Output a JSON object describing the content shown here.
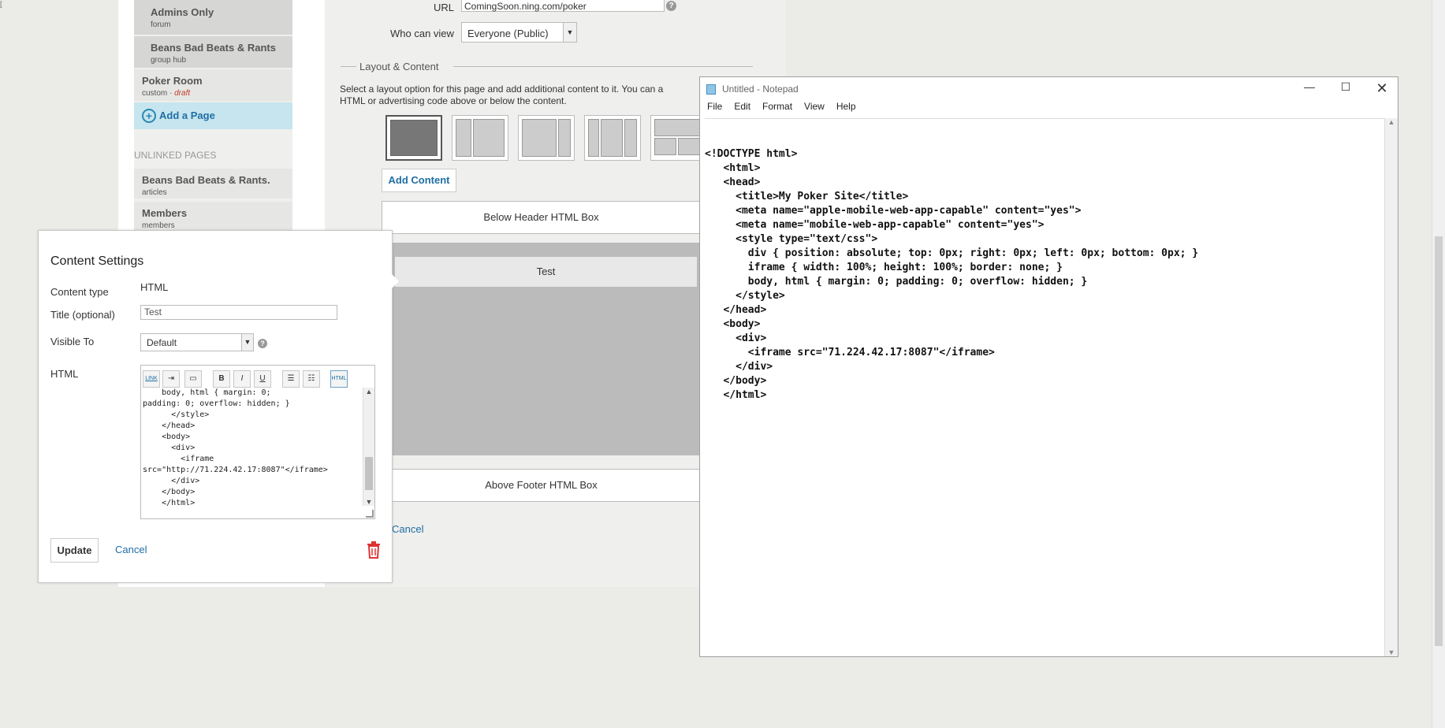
{
  "sidebar": {
    "items": [
      {
        "title": "Admins Only",
        "subtitle": "forum"
      },
      {
        "title": "Beans Bad Beats & Rants",
        "subtitle": "group hub"
      },
      {
        "title": "Poker Room",
        "subtitle": "custom",
        "status": "draft",
        "separator": " · "
      }
    ],
    "add_page": "Add a Page",
    "unlinked_heading": "UNLINKED PAGES",
    "unlinked": [
      {
        "title": "Beans Bad Beats & Rants.",
        "subtitle": "articles"
      },
      {
        "title": "Members",
        "subtitle": "members"
      }
    ]
  },
  "main": {
    "url_label": "URL",
    "url_prefix": "ComingSoon.ning.com/",
    "url_value": "poker",
    "who_label": "Who can view",
    "who_value": "Everyone (Public)",
    "section_title": "Layout & Content",
    "desc_line1": "Select a layout option for this page and add additional content to it. You can a",
    "desc_line2": "HTML or advertising code above or below the content.",
    "add_content": "Add Content",
    "below_header": "Below Header HTML Box",
    "test_bar": "Test",
    "above_footer": "Above Footer HTML Box",
    "cancel": "Cancel"
  },
  "content_settings": {
    "title": "Content Settings",
    "content_type_label": "Content type",
    "content_type_value": "HTML",
    "title_label": "Title (optional)",
    "title_value": "Test",
    "visible_label": "Visible To",
    "visible_value": "Default",
    "html_label": "HTML",
    "toolbar": {
      "link": "LINK",
      "bold": "B",
      "italic": "I",
      "underline": "U",
      "html": "HTML"
    },
    "code": "    body, html { margin: 0;\npadding: 0; overflow: hidden; }\n      </style>\n    </head>\n    <body>\n      <div>\n        <iframe\nsrc=\"http://71.224.42.17:8087\"</iframe>\n      </div>\n    </body>\n    </html>",
    "update": "Update",
    "cancel": "Cancel"
  },
  "notepad": {
    "title": "Untitled - Notepad",
    "menu": [
      "File",
      "Edit",
      "Format",
      "View",
      "Help"
    ],
    "text": "<!DOCTYPE html>\n   <html>\n   <head>\n     <title>My Poker Site</title>\n     <meta name=\"apple-mobile-web-app-capable\" content=\"yes\">\n     <meta name=\"mobile-web-app-capable\" content=\"yes\">\n     <style type=\"text/css\">\n       div { position: absolute; top: 0px; right: 0px; left: 0px; bottom: 0px; }\n       iframe { width: 100%; height: 100%; border: none; }\n       body, html { margin: 0; padding: 0; overflow: hidden; }\n     </style>\n   </head>\n   <body>\n     <div>\n       <iframe src=\"71.224.42.17:8087\"</iframe>\n     </div>\n   </body>\n   </html>"
  }
}
